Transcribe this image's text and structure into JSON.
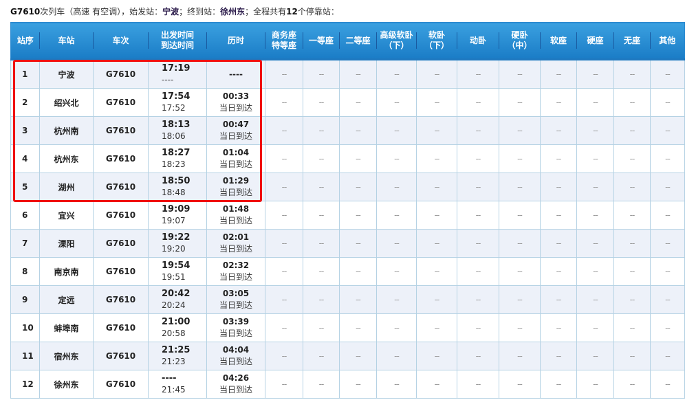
{
  "summary": {
    "train_no": "G7610",
    "text1": "次列车（高速 有空调），始发站：",
    "origin": "宁波",
    "text2": "；终到站：",
    "terminal": "徐州东",
    "text3": "；全程共有",
    "stop_count": "12",
    "text4": "个停靠站："
  },
  "headers": [
    [
      "站序"
    ],
    [
      "车站"
    ],
    [
      "车次"
    ],
    [
      "出发时间",
      "到达时间"
    ],
    [
      "历时"
    ],
    [
      "商务座",
      "特等座"
    ],
    [
      "一等座"
    ],
    [
      "二等座"
    ],
    [
      "高级软卧",
      "（下）"
    ],
    [
      "软卧",
      "（下）"
    ],
    [
      "动卧"
    ],
    [
      "硬卧",
      "（中）"
    ],
    [
      "软座"
    ],
    [
      "硬座"
    ],
    [
      "无座"
    ],
    [
      "其他"
    ]
  ],
  "seat_placeholder": "--",
  "highlight": {
    "color": "#f01010",
    "rows": [
      1,
      2,
      3,
      4,
      5
    ]
  },
  "colors": {
    "header_blue": "#1a7cc6",
    "row_alt": "#edf1f9",
    "border": "#b5d2e4"
  },
  "stops": [
    {
      "seq": "1",
      "station": "宁波",
      "train": "G7610",
      "depart": "17:19",
      "arrive": "----",
      "duration": "----",
      "day": ""
    },
    {
      "seq": "2",
      "station": "绍兴北",
      "train": "G7610",
      "depart": "17:54",
      "arrive": "17:52",
      "duration": "00:33",
      "day": "当日到达"
    },
    {
      "seq": "3",
      "station": "杭州南",
      "train": "G7610",
      "depart": "18:13",
      "arrive": "18:06",
      "duration": "00:47",
      "day": "当日到达"
    },
    {
      "seq": "4",
      "station": "杭州东",
      "train": "G7610",
      "depart": "18:27",
      "arrive": "18:23",
      "duration": "01:04",
      "day": "当日到达"
    },
    {
      "seq": "5",
      "station": "湖州",
      "train": "G7610",
      "depart": "18:50",
      "arrive": "18:48",
      "duration": "01:29",
      "day": "当日到达"
    },
    {
      "seq": "6",
      "station": "宜兴",
      "train": "G7610",
      "depart": "19:09",
      "arrive": "19:07",
      "duration": "01:48",
      "day": "当日到达"
    },
    {
      "seq": "7",
      "station": "溧阳",
      "train": "G7610",
      "depart": "19:22",
      "arrive": "19:20",
      "duration": "02:01",
      "day": "当日到达"
    },
    {
      "seq": "8",
      "station": "南京南",
      "train": "G7610",
      "depart": "19:54",
      "arrive": "19:51",
      "duration": "02:32",
      "day": "当日到达"
    },
    {
      "seq": "9",
      "station": "定远",
      "train": "G7610",
      "depart": "20:42",
      "arrive": "20:24",
      "duration": "03:05",
      "day": "当日到达"
    },
    {
      "seq": "10",
      "station": "蚌埠南",
      "train": "G7610",
      "depart": "21:00",
      "arrive": "20:58",
      "duration": "03:39",
      "day": "当日到达"
    },
    {
      "seq": "11",
      "station": "宿州东",
      "train": "G7610",
      "depart": "21:25",
      "arrive": "21:23",
      "duration": "04:04",
      "day": "当日到达"
    },
    {
      "seq": "12",
      "station": "徐州东",
      "train": "G7610",
      "depart": "----",
      "arrive": "21:45",
      "duration": "04:26",
      "day": "当日到达"
    }
  ]
}
